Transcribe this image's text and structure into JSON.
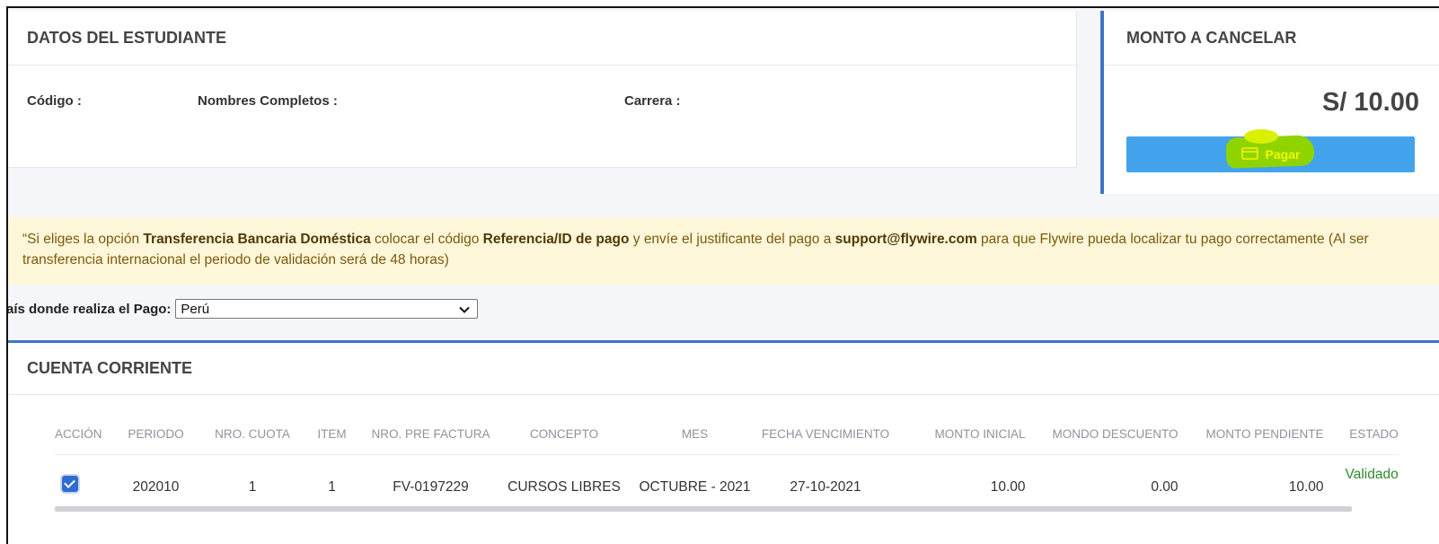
{
  "student_card": {
    "title": "DATOS DEL ESTUDIANTE",
    "code_label": "Código :",
    "names_label": "Nombres Completos :",
    "career_label": "Carrera :"
  },
  "amount_card": {
    "title": "MONTO A CANCELAR",
    "amount": "S/ 10.00",
    "pay_label": "Pagar",
    "pay_icon": "credit-card-icon",
    "highlight_color": "#8fd400"
  },
  "notice": {
    "t1": "“Si eliges la opción ",
    "b1": "Transferencia Bancaria Doméstica",
    "t2": " colocar el código ",
    "b2": "Referencia/ID de pago",
    "t3": " y envíe el justificante del pago a ",
    "b3": "support@flywire.com",
    "t4": " para que Flywire pueda localizar tu pago correctamente (Al ser transferencia internacional el periodo de validación será de 48 horas)"
  },
  "country": {
    "label": "aís donde realiza el Pago:",
    "selected": "Perú"
  },
  "account_card": {
    "title": "CUENTA CORRIENTE",
    "columns": [
      "ACCIÓN",
      "PERIODO",
      "NRO. CUOTA",
      "ITEM",
      "NRO. PRE FACTURA",
      "CONCEPTO",
      "MES",
      "FECHA VENCIMIENTO",
      "MONTO INICIAL",
      "MONDO DESCUENTO",
      "MONTO PENDIENTE",
      "ESTADO"
    ],
    "rows": [
      {
        "selected": true,
        "periodo": "202010",
        "cuota": "1",
        "item": "1",
        "prefactura": "FV-0197229",
        "concepto": "CURSOS LIBRES",
        "mes": "OCTUBRE - 2021",
        "vencimiento": "27-10-2021",
        "monto_inicial": "10.00",
        "descuento": "0.00",
        "pendiente": "10.00",
        "estado": "Validado"
      }
    ]
  },
  "colors": {
    "accent": "#3f75c8",
    "pay_button": "#42a3ec",
    "notice_bg": "#fdf6d9",
    "status_ok": "#2e8b2e"
  }
}
